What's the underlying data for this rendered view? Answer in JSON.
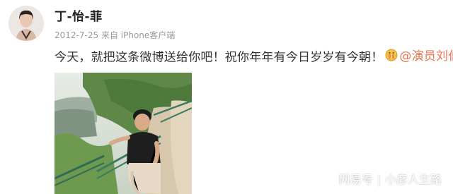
{
  "post": {
    "username": "丁-怡-菲",
    "date": "2012-7-25",
    "source_prefix": "来自",
    "client": "iPhone客户端",
    "text": "今天，就把这条微博送给你吧！祝你年年有今日岁岁有今朝！",
    "mention": "@演员刘伯勋",
    "emoji_icon": "gift-face-emoji-icon"
  },
  "watermark": {
    "platform": "网易号",
    "separator": "|",
    "account": "小彦人生路"
  },
  "colors": {
    "mention": "#eb7350",
    "meta": "#9a9a9a",
    "text": "#333333"
  }
}
